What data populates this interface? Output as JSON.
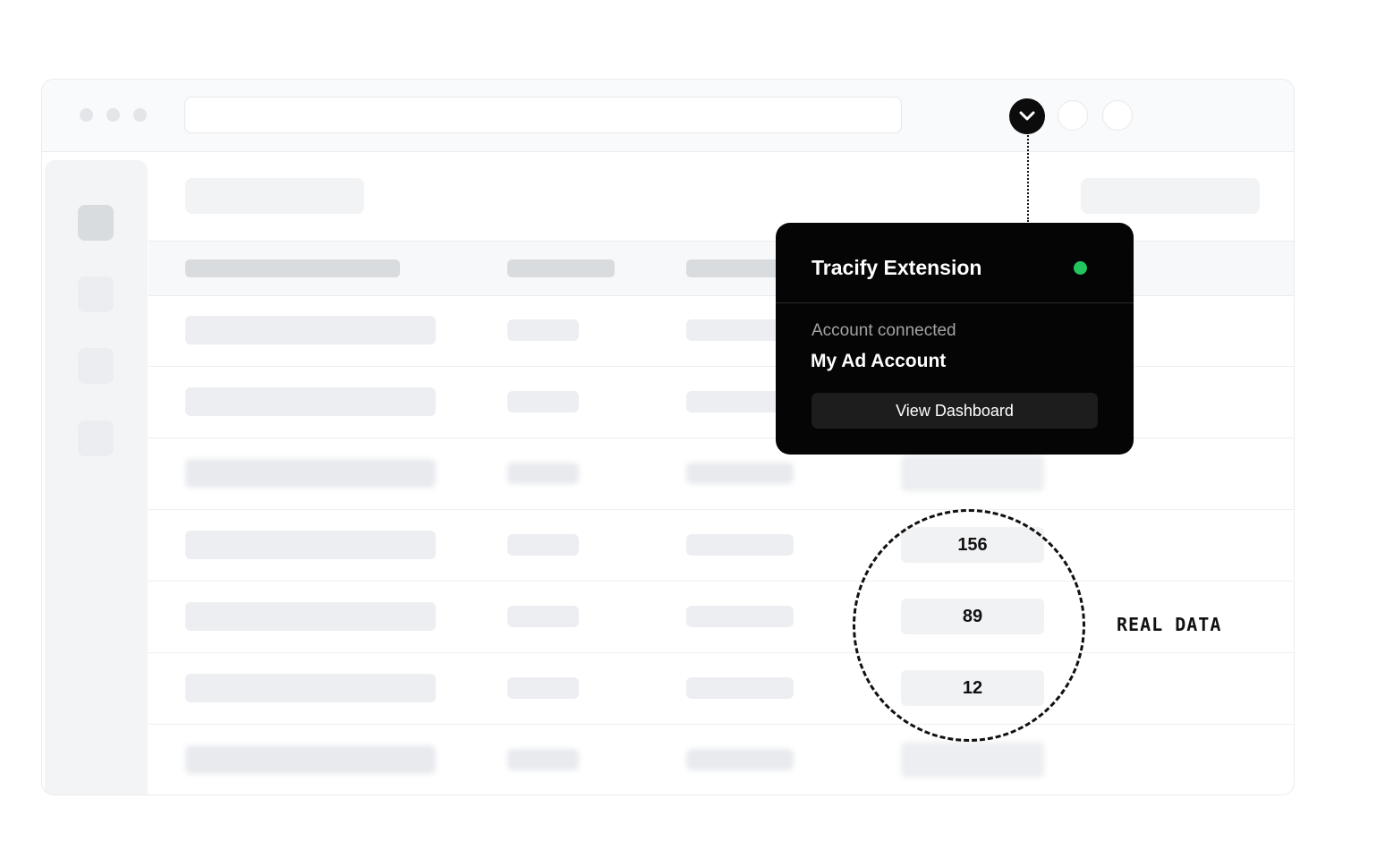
{
  "extension_popup": {
    "title": "Tracify Extension",
    "status": "connected",
    "status_color": "#22c55e",
    "subtitle": "Account connected",
    "account_name": "My Ad Account",
    "button_label": "View Dashboard"
  },
  "table": {
    "metric_values": [
      "156",
      "89",
      "12"
    ]
  },
  "annotation": {
    "label": "REAL DATA"
  },
  "icons": {
    "extension_toggle": "chevron-down-icon"
  }
}
